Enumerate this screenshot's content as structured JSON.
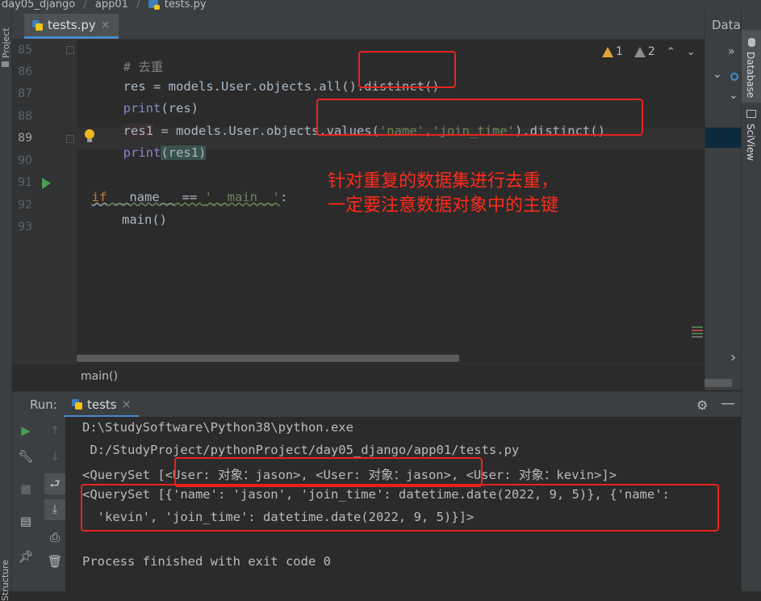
{
  "breadcrumb": [
    "day05_django",
    "app01",
    "tests.py"
  ],
  "left_strip": {
    "project_label": "Project",
    "structure_label": "Structure"
  },
  "editor_tab": {
    "label": "tests.py",
    "close": "×"
  },
  "inspection": {
    "warnings": "1",
    "weak_warnings": "2",
    "up": "⌃",
    "down": "⌄"
  },
  "lines": [
    {
      "num": "85",
      "tokens": [
        {
          "t": "# 去重",
          "c": "comment"
        }
      ]
    },
    {
      "num": "86",
      "tokens": [
        {
          "t": "res = models.User.objects.all().distinct()",
          "c": "var"
        }
      ]
    },
    {
      "num": "87",
      "tokens": [
        {
          "t": "print",
          "c": "builtin"
        },
        {
          "t": "(res)",
          "c": "var"
        }
      ]
    },
    {
      "num": "88",
      "tokens": [
        {
          "t": "res1",
          "c": "var"
        },
        {
          "t": " = models.User.objects.values(",
          "c": "var"
        },
        {
          "t": "'name'",
          "c": "str"
        },
        {
          "t": ",",
          "c": "kw"
        },
        {
          "t": "'join_time'",
          "c": "str"
        },
        {
          "t": ").distinct()",
          "c": "var"
        }
      ]
    },
    {
      "num": "89",
      "tokens": [
        {
          "t": "print",
          "c": "builtin"
        },
        {
          "t": "(res1)",
          "c": "var"
        }
      ]
    },
    {
      "num": "90",
      "tokens": []
    },
    {
      "num": "91",
      "tokens": [
        {
          "t": "if",
          "c": "kw"
        },
        {
          "t": " __name__ == ",
          "c": "var"
        },
        {
          "t": "'__main__'",
          "c": "str"
        },
        {
          "t": ":",
          "c": "var"
        }
      ]
    },
    {
      "num": "92",
      "tokens": [
        {
          "t": "    main()",
          "c": "var"
        }
      ]
    },
    {
      "num": "93",
      "tokens": []
    }
  ],
  "annotation": {
    "line1": "针对重复的数据集进行去重，",
    "line2": "一定要注意数据对象中的主键"
  },
  "editor_breadcrumb": "main()",
  "database_panel": {
    "title": "Database",
    "expand": "»",
    "chev1": "⌄",
    "chev2": "⌄",
    "more": "›"
  },
  "right_strip": {
    "database": "Database",
    "sciview": "SciView"
  },
  "run_window": {
    "label": "Run:",
    "tab_label": "tests",
    "tab_close": "×",
    "settings": "⚙",
    "hide": "—"
  },
  "console": [
    "D:\\StudySoftware\\Python38\\python.exe",
    " D:/StudyProject/pythonProject/day05_django/app01/tests.py",
    "<QuerySet [<User: 对象：jason>, <User: 对象：jason>, <User: 对象：kevin>]>",
    "<QuerySet [{'name': 'jason', 'join_time': datetime.date(2022, 9, 5)}, {'name':",
    "  'kevin', 'join_time': datetime.date(2022, 9, 5)}]>",
    "",
    "Process finished with exit code 0"
  ],
  "colors": {
    "background": "#2b2b2b",
    "comment": "#808080",
    "builtin": "#8888c6",
    "string": "#6a8759",
    "keyword": "#cc7832",
    "text": "#a9b7c6",
    "highlight_box": "#e8231e",
    "annotation": "#ff2a1a",
    "run_green": "#499c54"
  }
}
